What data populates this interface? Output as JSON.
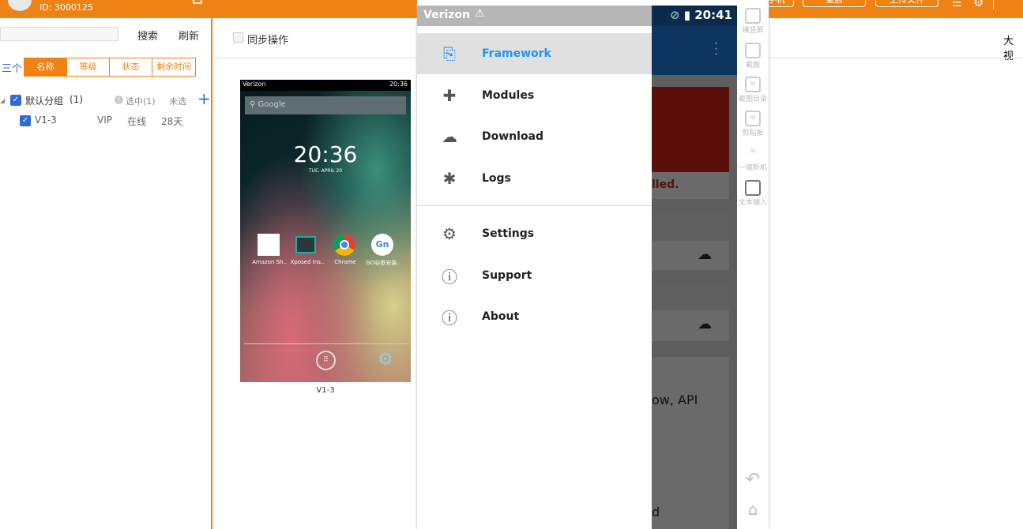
{
  "header": {
    "user_id": "ID: 3000125",
    "buttons": [
      "手机",
      "重启",
      "上传文件"
    ],
    "menu_icon": "hamburger-icon",
    "settings_icon": "gear-icon"
  },
  "sidebar": {
    "search_placeholder": "",
    "search_label": "搜索",
    "refresh_label": "刷新",
    "sort_prefix": "三个",
    "sort_tabs": [
      "名称",
      "等级",
      "状态",
      "剩余时间"
    ],
    "group": {
      "name": "默认分组",
      "count": "(1)",
      "selected": "选中(1)",
      "unselected": "未选"
    },
    "devices": [
      {
        "name": "V1-3",
        "level": "VIP",
        "status": "在线",
        "remaining": "28天"
      }
    ]
  },
  "main": {
    "sync_label": "同步操作",
    "view_label": "大视",
    "thumbnail": {
      "carrier": "Verizon",
      "time": "20:36",
      "search_hint": "Google",
      "clock": "20:36",
      "date": "TUE, APRIL 20",
      "apps": [
        "Amazon Sh..",
        "Xposed Ins..",
        "Chrome",
        "GO谷歌安装.."
      ],
      "caption": "V1-3"
    }
  },
  "phone": {
    "carrier": "Verizon",
    "time": "20:41",
    "drawer": [
      {
        "label": "Framework",
        "icon": "framework-icon",
        "selected": true
      },
      {
        "label": "Modules",
        "icon": "puzzle-icon"
      },
      {
        "label": "Download",
        "icon": "cloud-icon"
      },
      {
        "label": "Logs",
        "icon": "bug-icon"
      },
      {
        "label": "Settings",
        "icon": "gear-icon"
      },
      {
        "label": "Support",
        "icon": "help-icon"
      },
      {
        "label": "About",
        "icon": "info-icon"
      }
    ],
    "background_texts": [
      "lled.",
      "ow, API",
      "d"
    ]
  },
  "toolbar": {
    "items": [
      "横竖屏",
      "截图",
      "截图目录",
      "剪贴板",
      "一键新机",
      "文本输入"
    ]
  }
}
